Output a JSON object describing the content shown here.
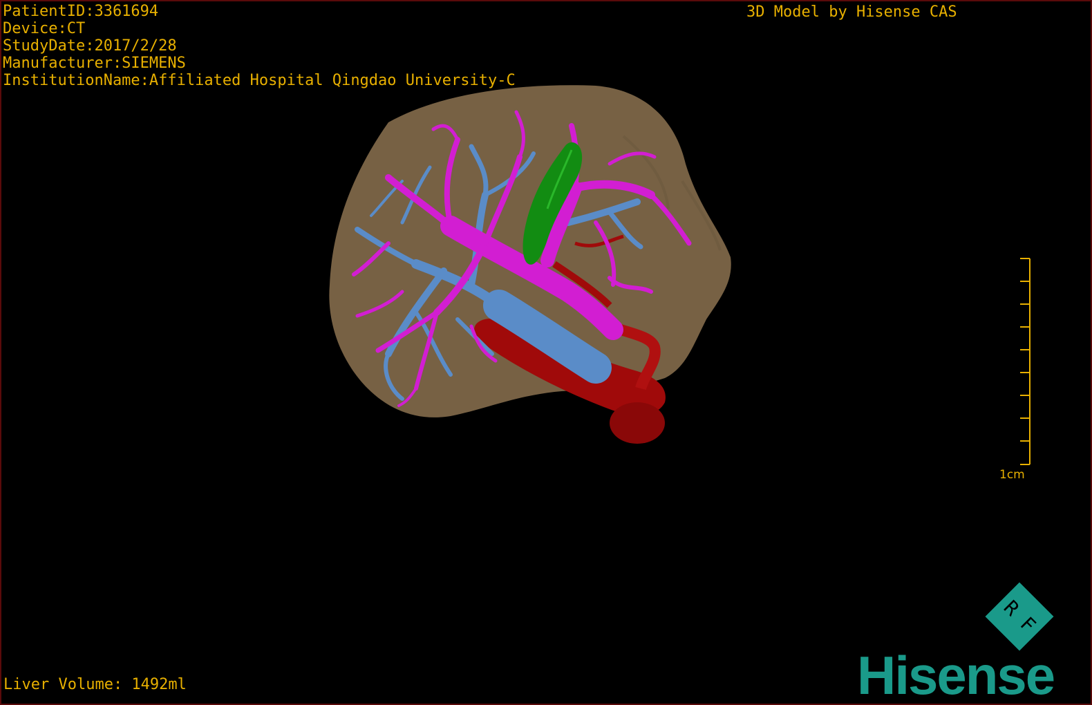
{
  "patient_info": {
    "patient_id": "PatientID:3361694",
    "device": "Device:CT",
    "study_date": "StudyDate:2017/2/28",
    "manufacturer": "Manufacturer:SIEMENS",
    "institution": "InstitutionName:Affiliated Hospital Qingdao University-C"
  },
  "credit": "3D Model by Hisense CAS",
  "liver_volume": "Liver Volume: 1492ml",
  "scale_bar": {
    "label": "1cm"
  },
  "logo": {
    "badge_text": "R F",
    "word": "Hisense",
    "color": "#1a9a8a"
  },
  "colors": {
    "text": "#e8b000",
    "liver": "#8c7250",
    "portal_vein": "#d21ed2",
    "hepatic_vein": "#5a8cc8",
    "artery": "#a00a0a",
    "gallbladder": "#128c12"
  }
}
